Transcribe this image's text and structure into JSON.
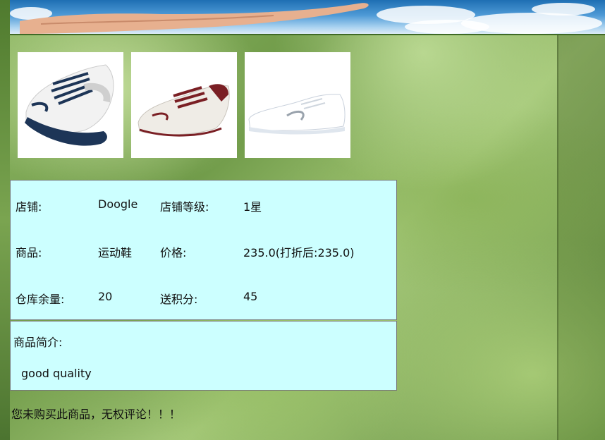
{
  "store": {
    "shop_label": "店铺:",
    "shop_value": "Doogle",
    "level_label": "店铺等级:",
    "level_value": "1星",
    "product_label": "商品:",
    "product_value": "运动鞋",
    "price_label": "价格:",
    "price_value": "235.0(打折后:235.0)",
    "stock_label": "仓库余量:",
    "stock_value": "20",
    "points_label": "送积分:",
    "points_value": "45"
  },
  "description": {
    "title": "商品简介:",
    "body": "good quality"
  },
  "review_notice": "您未购买此商品，无权评论！！！",
  "thumbnails": [
    {
      "name": "shoe-image-navy-runner",
      "accent": "#1d3557"
    },
    {
      "name": "shoe-image-maroon-trainer",
      "accent": "#7a1f24"
    },
    {
      "name": "shoe-image-white-lowtop",
      "accent": "#9aa3ad"
    }
  ]
}
